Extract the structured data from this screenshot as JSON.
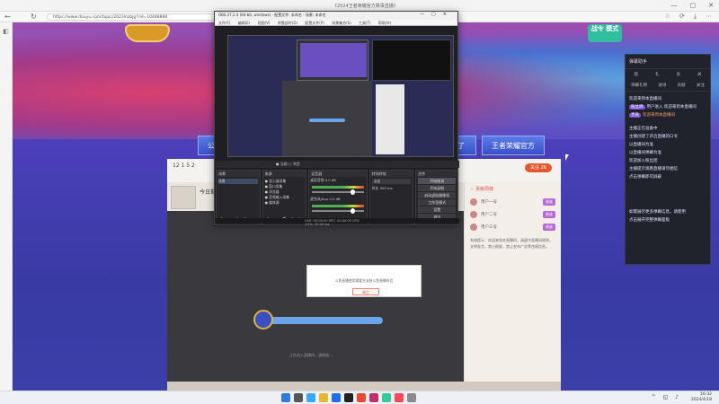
{
  "browser": {
    "title": "《2024王者荣耀官方赛事直播》",
    "url": "https://www.douyu.com/topic/2023lnzbjg?rid=10488888",
    "back": "←",
    "refresh": "↻",
    "window_controls": [
      "—",
      "▢",
      "✕"
    ],
    "toolbar_icons": [
      "☆",
      "⟳",
      "⤓",
      "⋯"
    ]
  },
  "page": {
    "logo_right": "战令\n模式",
    "event_buttons": [
      "公布战",
      "了",
      "王者荣耀官方"
    ],
    "room": {
      "stats": "12   1   5   2",
      "follow_label": "关注 26",
      "today_label": "今日剩..."
    },
    "dialog": {
      "text": "斗鱼直播使用需要先安装斗鱼直播伴侣",
      "button": "确定"
    },
    "loader_text": "正在进入直播间，请稍候...",
    "chat": {
      "header": "☆ 贡献周榜",
      "rows": [
        {
          "name": "用户一号",
          "tag": "贵族"
        },
        {
          "name": "用户二号",
          "tag": "贵族"
        },
        {
          "name": "用户三号",
          "tag": "贵族"
        }
      ],
      "text": "系统提示：欢迎来到本直播间，请遵守直播间规则，文明发言，禁止刷屏，禁止发布广告等违规信息。"
    }
  },
  "right_panel": {
    "title": "弹幕助手",
    "tabs1": [
      "观",
      "礼",
      "贡",
      "关"
    ],
    "tabs2": [
      "弹幕礼物",
      "进场",
      "贡献",
      "关注"
    ],
    "lines": [
      {
        "text": "欢迎来到本直播间",
        "style": "normal"
      },
      {
        "tag": "粉丝牌",
        "text": "用户进入 欢迎来到本直播间",
        "style": "tag"
      },
      {
        "tag": "贵族",
        "text": "欢迎来到本直播间",
        "style": "orange"
      },
      {
        "text": "主播正在准备中",
        "style": "normal"
      },
      {
        "text": "主播创建了开启直播的口令",
        "style": "normal"
      },
      {
        "text": "以直播间为准",
        "style": "normal"
      },
      {
        "text": "以直播间弹幕为准",
        "style": "normal"
      },
      {
        "text": "欢迎加入粉丝团",
        "style": "normal"
      },
      {
        "text": "主播提示观看直播请勿相信",
        "style": "normal"
      },
      {
        "text": "点击弹幕即可屏蔽",
        "style": "normal"
      }
    ],
    "footer_lines": [
      "如需展示更多弹幕信息，请使用",
      "点击展开完整弹幕面板"
    ]
  },
  "obs": {
    "title": "OBS 27.2.4 (64-bit, windows) - 配置文件: 未命名 - 场景: 未命名",
    "menu": [
      "文件(F)",
      "编辑(E)",
      "视图(V)",
      "停靠部件(D)",
      "配置文件(P)",
      "场景集合(S)",
      "工具(T)",
      "帮助(H)"
    ],
    "status_line": "● 当前 ○ 节目",
    "docks": {
      "scenes": {
        "header": "场景",
        "items": [
          "场景"
        ]
      },
      "sources": {
        "header": "来源",
        "items": [
          "● 显示器采集",
          "● 窗口采集",
          "● 浏览器",
          "● 音频输入采集",
          "● 媒体源"
        ]
      },
      "mixer": {
        "header": "混音器",
        "items": [
          "桌面音频 0.0 dB",
          "麦克风/Aux 0.0 dB"
        ]
      },
      "transitions": {
        "header": "转场特效",
        "items": [
          "淡出",
          "时长 300 ms"
        ]
      },
      "controls": {
        "header": "控件",
        "items": [
          "开始推流",
          "开始录制",
          "启动虚拟摄像机",
          "工作室模式",
          "设置",
          "退出"
        ]
      }
    },
    "foot": "LIVE: 00:00:00  REC: 00:00:00  CPU: 1.2%, 30.00 fps"
  },
  "taskbar": {
    "time": "16:32",
    "date": "2024/4/18",
    "tray": "^ ◱ ♪"
  },
  "colors": {
    "accent": "#e5582e",
    "page_purple": "#4a3fb8",
    "obs_bg": "#1f1f23"
  }
}
